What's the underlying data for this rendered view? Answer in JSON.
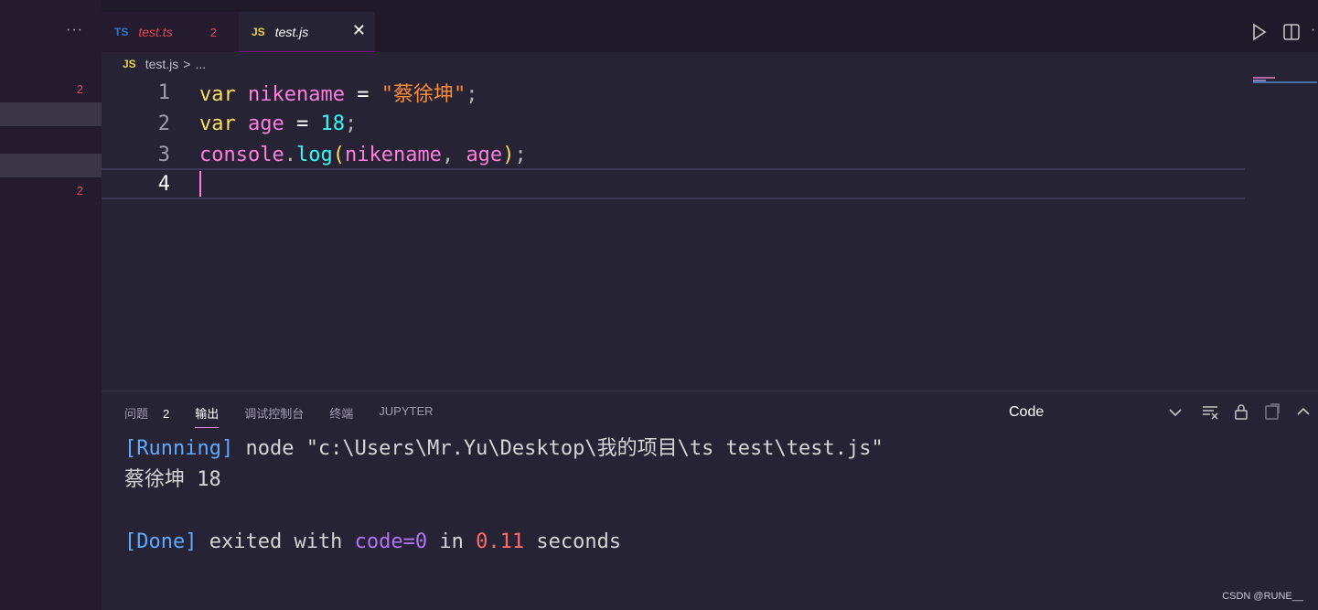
{
  "sidebar": {
    "more_label": "···",
    "badge_top": "2",
    "badge_bottom": "2"
  },
  "tabs": [
    {
      "lang": "TS",
      "name": "test.ts",
      "count": "2"
    },
    {
      "lang": "JS",
      "name": "test.js",
      "close": "✕"
    }
  ],
  "breadcrumb": {
    "lang": "JS",
    "file": "test.js",
    "sep": ">",
    "more": "..."
  },
  "editor": {
    "lines": [
      {
        "number": "1"
      },
      {
        "number": "2"
      },
      {
        "number": "3"
      },
      {
        "number": "4"
      }
    ],
    "code": {
      "l1": {
        "kw": "var",
        "name": "nikename",
        "op": "=",
        "str": "\"蔡徐坤\"",
        "end": ";"
      },
      "l2": {
        "kw": "var",
        "name": "age",
        "op": "=",
        "num": "18",
        "end": ";"
      },
      "l3": {
        "obj": "console",
        "dot": ".",
        "fn": "log",
        "open": "(",
        "a1": "nikename",
        "comma": ",",
        "a2": "age",
        "close": ")",
        "end": ";"
      }
    }
  },
  "panel": {
    "tabs": [
      {
        "label": "问题",
        "count": "2"
      },
      {
        "label": "输出"
      },
      {
        "label": "调试控制台"
      },
      {
        "label": "终端"
      },
      {
        "label": "JUPYTER"
      }
    ],
    "output_channel": "Code",
    "output": {
      "running_tag": "[Running]",
      "running_cmd": " node \"c:\\Users\\Mr.Yu\\Desktop\\我的项目\\ts test\\test.js\"",
      "result": "蔡徐坤 18",
      "done_tag": "[Done]",
      "done_text1": " exited with ",
      "done_code": "code=0",
      "done_text2": " in ",
      "done_time": "0.11",
      "done_text3": " seconds"
    }
  },
  "watermark": "CSDN @RUNE__",
  "colors": {
    "accent": "#ff7edb",
    "error": "#e5484d",
    "background": "#262335"
  }
}
